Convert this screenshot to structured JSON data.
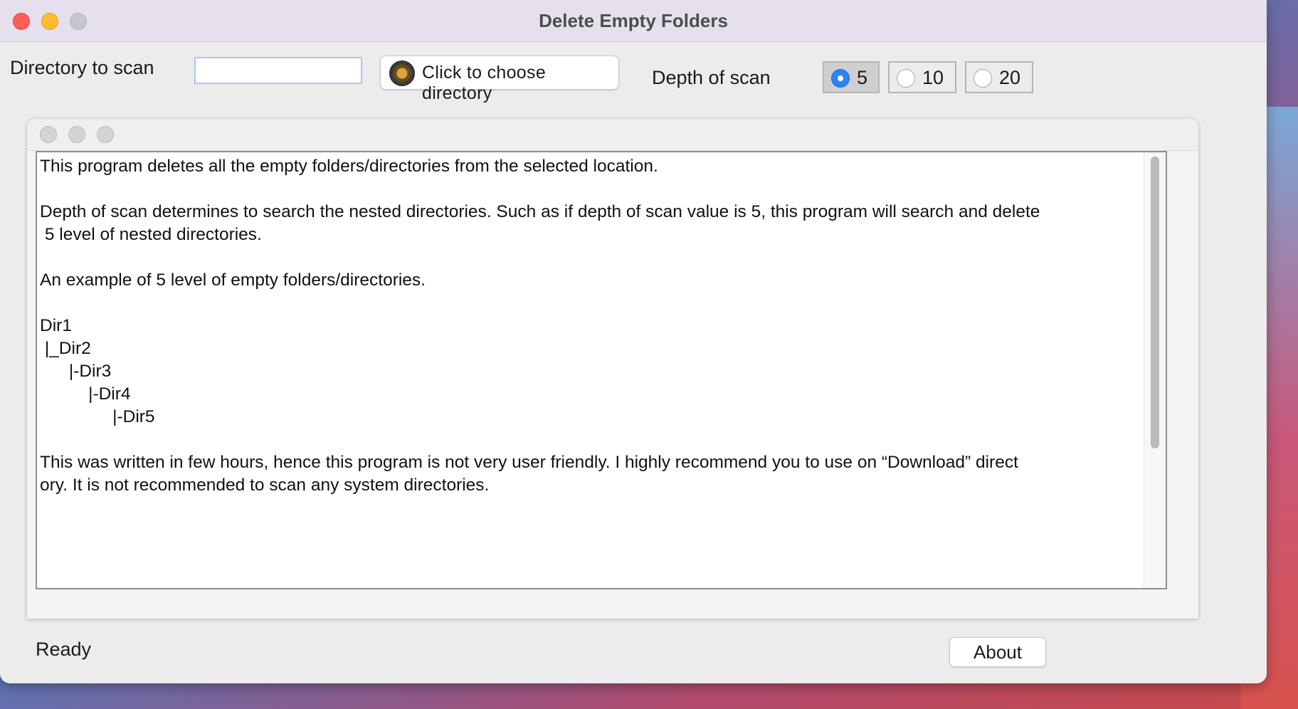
{
  "window": {
    "title": "Delete Empty Folders"
  },
  "toolbar": {
    "directory_label": "Directory to scan",
    "directory_value": "",
    "choose_button_label": "Click to choose directory",
    "depth_label": "Depth of scan",
    "depth_options": [
      {
        "label": "5",
        "selected": true
      },
      {
        "label": "10",
        "selected": false
      },
      {
        "label": "20",
        "selected": false
      }
    ]
  },
  "info_text": "This program deletes all the empty folders/directories from the selected location.\n\nDepth of scan determines to search the nested directories. Such as if depth of scan value is 5, this program will search and delete\n 5 level of nested directories.\n\nAn example of 5 level of empty folders/directories.\n\nDir1\n |_Dir2\n      |-Dir3\n          |-Dir4\n               |-Dir5\n\nThis was written in few hours, hence this program is not very user friendly. I highly recommend you to use on “Download” direct\nory. It is not recommended to scan any system directories.",
  "status": {
    "text": "Ready"
  },
  "about_button_label": "About",
  "colors": {
    "accent": "#2a84f5",
    "close": "#fe5f57",
    "minimize": "#febc2e"
  }
}
